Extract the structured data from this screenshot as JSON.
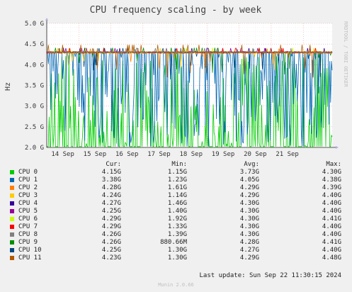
{
  "chart_data": {
    "type": "line",
    "title": "CPU frequency scaling - by week",
    "ylabel": "Hz",
    "side_text": "RRDTOOL / TOBI OETIKER",
    "ylim": [
      2.0,
      5.0
    ],
    "ytick_values": [
      2.0,
      2.5,
      3.0,
      3.5,
      4.0,
      4.5,
      5.0
    ],
    "yticks": [
      "2.0 G",
      "2.5 G",
      "3.0 G",
      "3.5 G",
      "4.0 G",
      "4.5 G",
      "5.0 G"
    ],
    "x_range_days": [
      0,
      8.9
    ],
    "xtick_values": [
      0.5,
      1.5,
      2.5,
      3.5,
      4.5,
      5.5,
      6.5,
      7.5
    ],
    "xticks": [
      "14 Sep",
      "15 Sep",
      "16 Sep",
      "17 Sep",
      "18 Sep",
      "19 Sep",
      "20 Sep",
      "21 Sep"
    ],
    "grid": true,
    "legend_headers": [
      "Cur:",
      "Min:",
      "Avg:",
      "Max:"
    ],
    "series": [
      {
        "name": "CPU 0",
        "color": "#00cc00",
        "cur": "4.15G",
        "min": "1.15G",
        "avg": "3.73G",
        "max": "4.30G"
      },
      {
        "name": "CPU 1",
        "color": "#0066b3",
        "cur": "3.38G",
        "min": "1.23G",
        "avg": "4.05G",
        "max": "4.38G"
      },
      {
        "name": "CPU 2",
        "color": "#ff8000",
        "cur": "4.28G",
        "min": "1.61G",
        "avg": "4.29G",
        "max": "4.39G"
      },
      {
        "name": "CPU 3",
        "color": "#ffcc00",
        "cur": "4.24G",
        "min": "1.14G",
        "avg": "4.29G",
        "max": "4.40G"
      },
      {
        "name": "CPU 4",
        "color": "#330099",
        "cur": "4.27G",
        "min": "1.46G",
        "avg": "4.30G",
        "max": "4.40G"
      },
      {
        "name": "CPU 5",
        "color": "#990099",
        "cur": "4.25G",
        "min": "1.40G",
        "avg": "4.30G",
        "max": "4.40G"
      },
      {
        "name": "CPU 6",
        "color": "#ccff00",
        "cur": "4.29G",
        "min": "1.92G",
        "avg": "4.30G",
        "max": "4.41G"
      },
      {
        "name": "CPU 7",
        "color": "#ff0000",
        "cur": "4.29G",
        "min": "1.33G",
        "avg": "4.30G",
        "max": "4.40G"
      },
      {
        "name": "CPU 8",
        "color": "#808080",
        "cur": "4.26G",
        "min": "1.39G",
        "avg": "4.30G",
        "max": "4.40G"
      },
      {
        "name": "CPU 9",
        "color": "#008f00",
        "cur": "4.26G",
        "min": "880.66M",
        "avg": "4.28G",
        "max": "4.41G"
      },
      {
        "name": "CPU 10",
        "color": "#00487d",
        "cur": "4.25G",
        "min": "1.30G",
        "avg": "4.27G",
        "max": "4.40G"
      },
      {
        "name": "CPU 11",
        "color": "#b35a00",
        "cur": "4.23G",
        "min": "1.30G",
        "avg": "4.29G",
        "max": "4.48G"
      }
    ]
  },
  "footer": {
    "last_update": "Last update: Sun Sep 22 11:30:15 2024",
    "munin": "Munin 2.0.66"
  }
}
